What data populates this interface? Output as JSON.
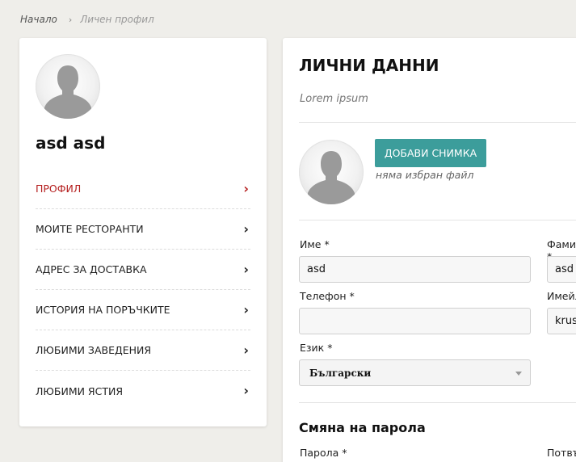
{
  "breadcrumb": {
    "home": "Начало",
    "separator": "›",
    "current": "Личен профил"
  },
  "sidebar": {
    "username": "asd asd",
    "items": [
      {
        "label": "ПРОФИЛ",
        "active": true
      },
      {
        "label": "МОИТЕ РЕСТОРАНТИ"
      },
      {
        "label": "АДРЕС ЗА ДОСТАВКА"
      },
      {
        "label": "ИСТОРИЯ НА ПОРЪЧКИТЕ"
      },
      {
        "label": "ЛЮБИМИ ЗАВЕДЕНИЯ"
      },
      {
        "label": "ЛЮБИМИ ЯСТИЯ"
      }
    ]
  },
  "main": {
    "title": "ЛИЧНИ ДАННИ",
    "subtitle": "Lorem ipsum",
    "upload_label": "ДОБАВИ СНИМКА",
    "no_file": "няма избран файл",
    "fields": {
      "first_name_label": "Име *",
      "first_name_value": "asd",
      "last_name_label": "Фамилия *",
      "last_name_value": "asd",
      "phone_label": "Телефон *",
      "phone_value": "",
      "email_label": "Имейл *",
      "email_value": "kruse",
      "language_label": "Език *",
      "language_value": "Български"
    },
    "password_section_title": "Смяна на парола",
    "password_label": "Парола *",
    "confirm_password_label": "Потвърди парола *"
  },
  "colors": {
    "accent": "#3c9d9b",
    "active": "#b51f1f",
    "background": "#efeeea"
  }
}
